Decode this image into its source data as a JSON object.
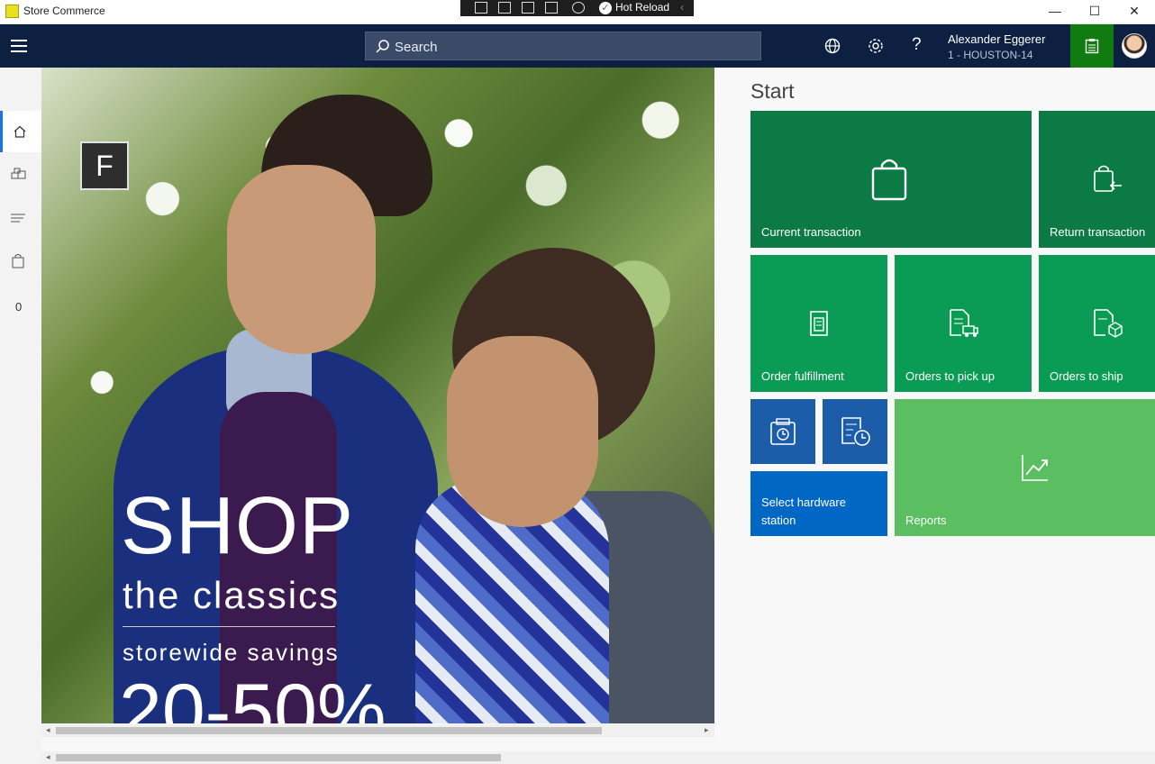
{
  "titlebar": {
    "app_title": "Store Commerce",
    "dev_toolbar": {
      "hot_reload_label": "Hot Reload"
    },
    "window_controls": {
      "minimize": "—",
      "maximize": "☐",
      "close": "✕"
    }
  },
  "topbar": {
    "search_placeholder": "Search",
    "help_icon": "?",
    "user_name": "Alexander Eggerer",
    "store_label": "1 - HOUSTON-14"
  },
  "leftnav": {
    "items": [
      {
        "name": "home-icon"
      },
      {
        "name": "products-icon"
      },
      {
        "name": "list-icon"
      },
      {
        "name": "bag-icon"
      }
    ],
    "count": "0"
  },
  "hero": {
    "badge": "F",
    "headline": "SHOP",
    "sub": "the classics",
    "savings": "storewide  savings",
    "percent": "20-50%"
  },
  "start": {
    "title": "Start",
    "tiles": [
      {
        "label": "Current transaction",
        "color": "#0c7a44"
      },
      {
        "label": "Return transaction",
        "color": "#0c7a44"
      },
      {
        "label": "Order fulfillment",
        "color": "#0a9c55"
      },
      {
        "label": "Orders to pick up",
        "color": "#0a9c55"
      },
      {
        "label": "Orders to ship",
        "color": "#0a9c55"
      },
      {
        "label": "Select hardware station",
        "color": "#0067c5"
      },
      {
        "label": "Reports",
        "color": "#5bbf62"
      }
    ]
  },
  "colors": {
    "topbar": "#0d2042",
    "accent": "#1a73e8",
    "green_button": "#107c10",
    "dark_blue_tile": "#1b5da8"
  }
}
